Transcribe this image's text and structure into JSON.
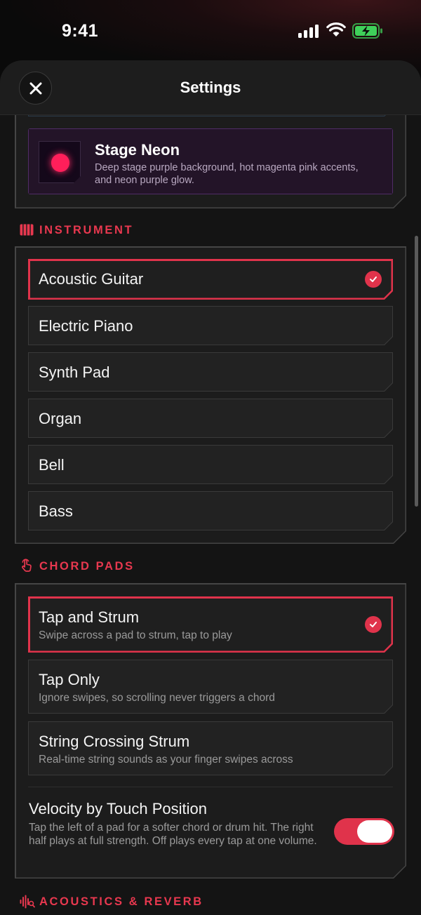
{
  "status_bar": {
    "time": "9:41"
  },
  "header": {
    "title": "Settings"
  },
  "theme": {
    "name": "Stage Neon",
    "description": "Deep stage purple background, hot magenta pink accents, and neon purple glow."
  },
  "instrument": {
    "section_title": "INSTRUMENT",
    "options": [
      {
        "label": "Acoustic Guitar",
        "selected": true
      },
      {
        "label": "Electric Piano",
        "selected": false
      },
      {
        "label": "Synth Pad",
        "selected": false
      },
      {
        "label": "Organ",
        "selected": false
      },
      {
        "label": "Bell",
        "selected": false
      },
      {
        "label": "Bass",
        "selected": false
      }
    ]
  },
  "chord_pads": {
    "section_title": "CHORD PADS",
    "options": [
      {
        "label": "Tap and Strum",
        "description": "Swipe across a pad to strum, tap to play",
        "selected": true
      },
      {
        "label": "Tap Only",
        "description": "Ignore swipes, so scrolling never triggers a chord",
        "selected": false
      },
      {
        "label": "String Crossing Strum",
        "description": "Real-time string sounds as your finger swipes across",
        "selected": false
      }
    ],
    "velocity": {
      "title": "Velocity by Touch Position",
      "description": "Tap the left of a pad for a softer chord or drum hit. The right half plays at full strength. Off plays every tap at one volume.",
      "enabled": true
    }
  },
  "acoustics": {
    "section_title": "ACOUSTICS & REVERB"
  },
  "colors": {
    "accent": "#e0334b",
    "background": "#141414",
    "panel": "#1c1c1c",
    "theme_swatch": "#ff1f5a"
  }
}
